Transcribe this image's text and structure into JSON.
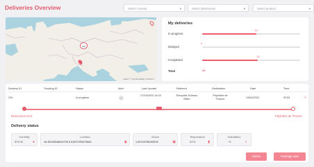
{
  "app": {
    "title": "Deliveries Overview"
  },
  "filters": {
    "country": "Select Country",
    "warehouse": "Select Warehouse",
    "product": "Select product"
  },
  "map": {
    "credit": "Leaflet | © OpenStreetMap contributors",
    "markers": [
      {
        "label": "15h"
      }
    ]
  },
  "summary": {
    "title": "My deliveries",
    "rows": [
      {
        "label": "In progress",
        "value": "14",
        "fraction": 0.55
      },
      {
        "label": "Delayed",
        "value": "0",
        "fraction": 0.0
      },
      {
        "label": "Completed",
        "value": "15",
        "fraction": 0.57
      }
    ],
    "total_label": "Total",
    "total_value": "29"
  },
  "table": {
    "headers": [
      "Delivery ID",
      "Tracking ID",
      "Status",
      "Alert",
      "Last Update",
      "Referent",
      "Destination",
      "Date",
      "Time"
    ],
    "row": {
      "delivery_id": "234",
      "tracking_id": "",
      "status": "In progress",
      "alert_icon": "info-icon",
      "last_update": "27/04/2022 14:03",
      "referent": "Théophile Driveau-Billon",
      "destination": "Pépinière de Thonon",
      "date": "14/04/2022",
      "time": "02:54"
    }
  },
  "route": {
    "origin": "Monoceros SAS",
    "destination": "Pépinière de Thonon",
    "progress": 0.5
  },
  "delivery_status": {
    "title": "Delivery status",
    "items": [
      {
        "label": "Humidity",
        "value": "37.5 %",
        "icon": "drop-icon"
      },
      {
        "label": "Location",
        "value": "46.36150546815799,5.51907939473664",
        "icon": "pin-icon"
      },
      {
        "label": "Shock",
        "value": "1.05745785195929",
        "icon": "shock-icon"
      },
      {
        "label": "Temperature",
        "value": "21°C",
        "icon": "thermometer-icon"
      },
      {
        "label": "Orientation",
        "value": "~2",
        "icon": "orientation-icon"
      }
    ]
  },
  "actions": {
    "delete": "Delete",
    "package_view": "Package view"
  },
  "colors": {
    "accent": "#e35b6c",
    "bar": "#ef5a6c",
    "button": "#f48592"
  }
}
